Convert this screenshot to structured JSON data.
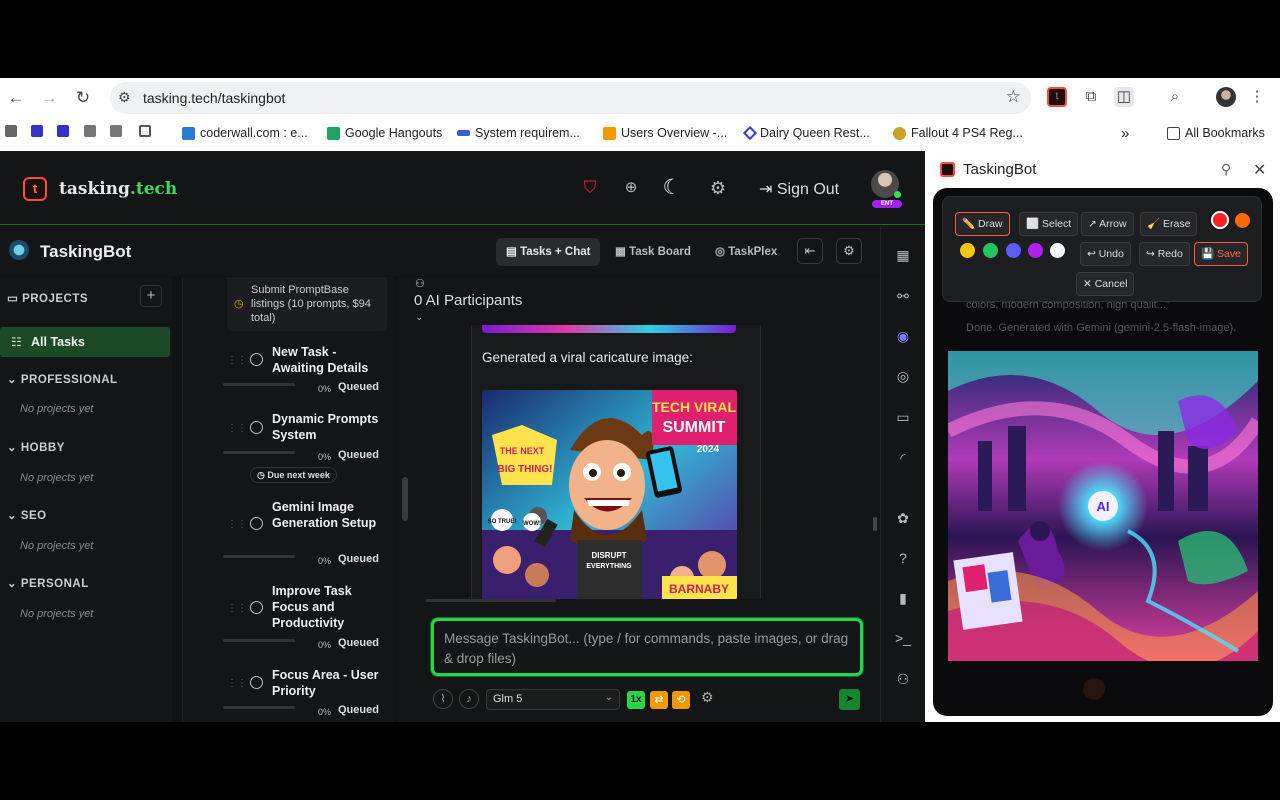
{
  "browser": {
    "url": "tasking.tech/taskingbot",
    "bookmarks": [
      "coderwall.com : e...",
      "Google Hangouts",
      "System requirem...",
      "Users Overview -...",
      "Dairy Queen Rest...",
      "Fallout 4 PS4 Reg..."
    ],
    "all_bookmarks": "All Bookmarks"
  },
  "header": {
    "logo_main": "tasking",
    "logo_dot": ".tech",
    "sign_out": "Sign Out",
    "badge": "ENT"
  },
  "titlebar": {
    "title": "TaskingBot",
    "tabs": [
      "Tasks + Chat",
      "Task Board",
      "TaskPlex"
    ]
  },
  "projects": {
    "heading": "PROJECTS",
    "all_tasks": "All Tasks",
    "groups": [
      {
        "name": "PROFESSIONAL",
        "empty": "No projects yet"
      },
      {
        "name": "HOBBY",
        "empty": "No projects yet"
      },
      {
        "name": "SEO",
        "empty": "No projects yet"
      },
      {
        "name": "PERSONAL",
        "empty": "No projects yet"
      }
    ]
  },
  "tasks": {
    "top_item": "Submit PromptBase listings (10 prompts, $94 total)",
    "due_badge": "Due next week",
    "items": [
      {
        "title": "New Task - Awaiting Details",
        "pct": "0%",
        "status": "Queued"
      },
      {
        "title": "Dynamic Prompts System",
        "pct": "0%",
        "status": "Queued"
      },
      {
        "title": "Gemini Image Generation Setup",
        "pct": "0%",
        "status": "Queued"
      },
      {
        "title": "Improve Task Focus and Productivity",
        "pct": "0%",
        "status": "Queued"
      },
      {
        "title": "Focus Area - User Priority",
        "pct": "0%",
        "status": "Queued"
      }
    ]
  },
  "chat": {
    "participants": "0 AI Participants",
    "message": "Generated a viral caricature image:",
    "image_text": {
      "headline1": "TECH VIRAL",
      "headline2": "SUMMIT",
      "year": "2024",
      "bubble": "THE NEXT BIG THING!",
      "shirt": "DISRUPT EVERYTHING",
      "name": "BARNABY BYTES",
      "so_true": "SO TRUE!",
      "wow": "WOW!"
    },
    "composer_placeholder": "Message TaskingBot... (type / for commands, paste images, or drag & drop files)",
    "model": "Glm 5",
    "speed": "1x"
  },
  "panel": {
    "title": "TaskingBot",
    "tools": {
      "draw": "✏️ Draw",
      "select": "⬜ Select",
      "arrow": "↗ Arrow",
      "erase": "🧹 Erase",
      "undo": "↩ Undo",
      "redo": "↪ Redo",
      "save": "💾 Save",
      "cancel": "✕ Cancel"
    },
    "colors": [
      "#ff2222",
      "#ff6a00",
      "#f5c518",
      "#22c55e",
      "#5b5bff",
      "#b020f0",
      "#ffffff"
    ],
    "behind_text_1": "colors, modern composition, high qualit...\"",
    "behind_text_2": "Done. Generated with Gemini (gemini-2.5-flash-image)."
  },
  "colors": {
    "accent_green": "#27d44a",
    "accent_orange": "#ff5a3c"
  }
}
